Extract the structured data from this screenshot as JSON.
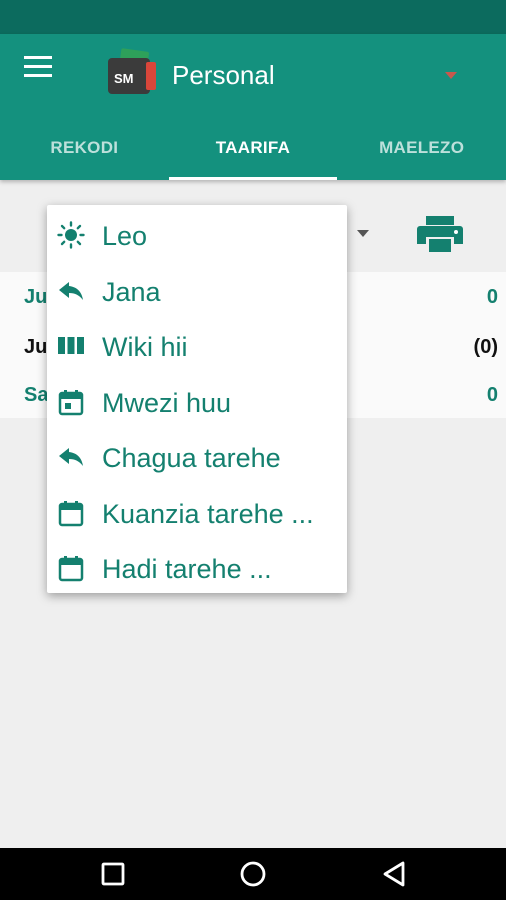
{
  "app_bar": {
    "title": "Personal",
    "logo_text": "SM",
    "menu_icon": "hamburger-menu-icon",
    "dropdown_icon": "caret-down-icon"
  },
  "tabs": [
    {
      "label": "REKODI",
      "active": false
    },
    {
      "label": "TAARIFA",
      "active": true
    },
    {
      "label": "MAELEZO",
      "active": false
    }
  ],
  "filter": {
    "dropdown_icon": "caret-down-icon",
    "print_icon": "printer-icon"
  },
  "summary": {
    "rows": [
      {
        "label": "Ju",
        "value": "0"
      },
      {
        "label": "Ju",
        "value": "(0)"
      },
      {
        "label": "Sa",
        "value": "0"
      }
    ]
  },
  "popup_menu": {
    "items": [
      {
        "label": "Leo",
        "icon": "sun-icon"
      },
      {
        "label": "Jana",
        "icon": "reply-arrow-icon"
      },
      {
        "label": "Wiki hii",
        "icon": "week-columns-icon"
      },
      {
        "label": "Mwezi huu",
        "icon": "calendar-day-icon"
      },
      {
        "label": "Chagua tarehe",
        "icon": "reply-arrow-icon"
      },
      {
        "label": "Kuanzia tarehe ...",
        "icon": "calendar-icon"
      },
      {
        "label": "Hadi tarehe ...",
        "icon": "calendar-icon"
      }
    ]
  },
  "nav_bar": {
    "icons": [
      "recents-square-icon",
      "home-circle-icon",
      "back-triangle-icon"
    ]
  },
  "colors": {
    "primary": "#14917e",
    "primary_dark": "#0c6b5e",
    "accent_text": "#14806f",
    "background": "#efefef"
  }
}
